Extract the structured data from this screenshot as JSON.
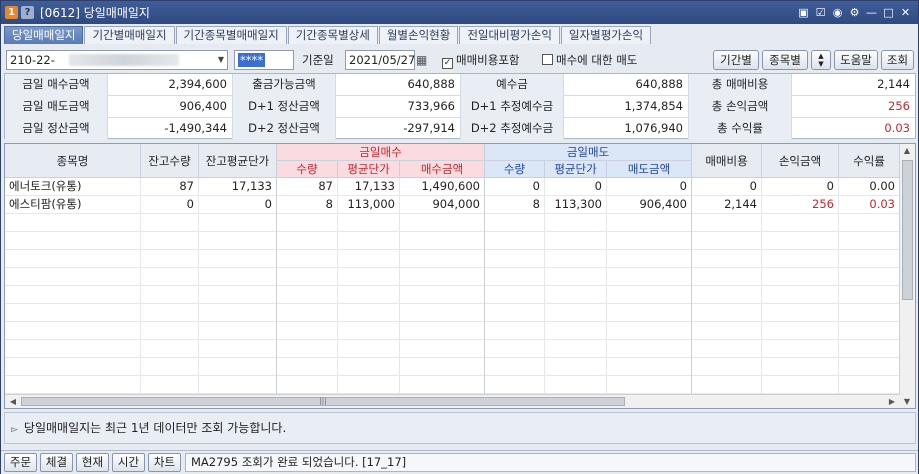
{
  "window": {
    "badge1": "1",
    "badge2": "?",
    "title": "[0612] 당일매매일지",
    "icons": [
      "memo-icon",
      "checklist-icon",
      "camera-icon",
      "settings-icon",
      "minimize-icon",
      "maximize-icon",
      "close-icon"
    ]
  },
  "tabs": [
    "당일매매일지",
    "기간별매매일지",
    "기간종목별매매일지",
    "기간종목별상세",
    "월별손익현황",
    "전일대비평가손익",
    "일자별평가손익"
  ],
  "active_tab": 0,
  "query": {
    "account": "210-22-",
    "password": "****",
    "date_label": "기준일",
    "date_value": "2021/05/27",
    "check1_label": "매매비용포함",
    "check1_checked": true,
    "check2_label": "매수에 대한 매도",
    "check2_checked": false,
    "btn_period": "기간별",
    "btn_stock": "종목별",
    "btn_help": "도움말",
    "btn_query": "조회"
  },
  "summary": [
    [
      {
        "label": "금일 매수금액",
        "value": "2,394,600"
      },
      {
        "label": "출금가능금액",
        "value": "640,888"
      },
      {
        "label": "예수금",
        "value": "640,888"
      },
      {
        "label": "총 매매비용",
        "value": "2,144",
        "red": false
      }
    ],
    [
      {
        "label": "금일 매도금액",
        "value": "906,400"
      },
      {
        "label": "D+1 정산금액",
        "value": "733,966"
      },
      {
        "label": "D+1 추정예수금",
        "value": "1,374,854"
      },
      {
        "label": "총 손익금액",
        "value": "256",
        "red": true
      }
    ],
    [
      {
        "label": "금일 정산금액",
        "value": "-1,490,344"
      },
      {
        "label": "D+2 정산금액",
        "value": "-297,914"
      },
      {
        "label": "D+2 추정예수금",
        "value": "1,076,940"
      },
      {
        "label": "총 수익률",
        "value": "0.03",
        "red": true
      }
    ]
  ],
  "grid": {
    "headers": {
      "name": "종목명",
      "hold_qty": "잔고수량",
      "hold_avg": "잔고평균단가",
      "buy_group": "금일매수",
      "buy_qty": "수량",
      "buy_avg": "평균단가",
      "buy_amt": "매수금액",
      "sell_group": "금일매도",
      "sell_qty": "수량",
      "sell_avg": "평균단가",
      "sell_amt": "매도금액",
      "fee": "매매비용",
      "pnl": "손익금액",
      "rate": "수익률"
    },
    "rows": [
      [
        "에너토크(유통)",
        "87",
        "17,133",
        "87",
        "17,133",
        "1,490,600",
        "0",
        "0",
        "0",
        "0",
        "0",
        "0.00"
      ],
      [
        "에스티팜(유통)",
        "0",
        "0",
        "8",
        "113,000",
        "904,000",
        "8",
        "113,300",
        "906,400",
        "2,144",
        "256",
        "0.03"
      ]
    ],
    "red_cols_row2": [
      10,
      11
    ]
  },
  "notice": "당일매매일지는 최근 1년 데이터만 조회 가능합니다.",
  "statusbar": {
    "buttons": [
      "주문",
      "체결",
      "현재",
      "시간",
      "차트"
    ],
    "message": "MA2795 조회가 완료 되었습니다. [17_17]"
  },
  "colors": {
    "title_bar": "#3f5d99",
    "buy_header": "#fadbe0",
    "sell_header": "#dbe6f7",
    "profit_red": "#c8262c"
  }
}
